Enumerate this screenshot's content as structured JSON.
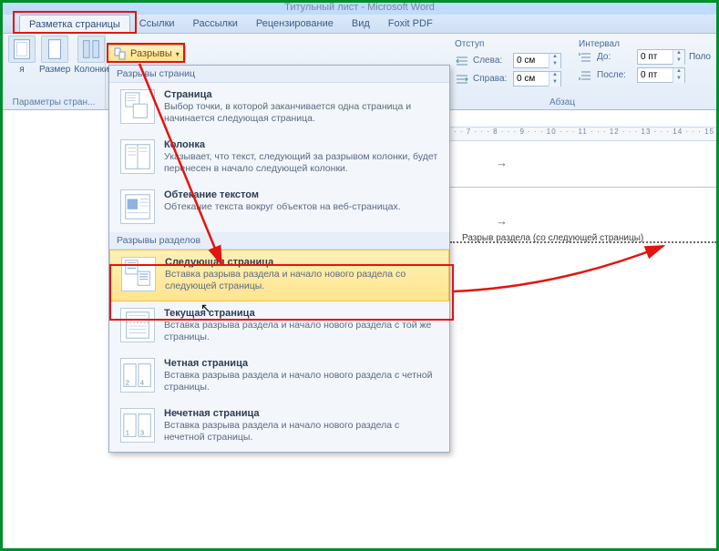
{
  "window": {
    "title": "Титульный лист - Microsoft Word"
  },
  "tabs": {
    "items": [
      "Разметка страницы",
      "Ссылки",
      "Рассылки",
      "Рецензирование",
      "Вид",
      "Foxit PDF"
    ],
    "active_index": 0
  },
  "ribbon": {
    "params_group_label": "Параметры стран...",
    "size_btn": "Размер",
    "columns_btn": "Колонки",
    "margins_btn": "я",
    "breaks_btn": "Разрывы",
    "indent": {
      "header": "Отступ",
      "left_label": "Слева:",
      "right_label": "Справа:",
      "left_value": "0 см",
      "right_value": "0 см"
    },
    "interval": {
      "header": "Интервал",
      "before_label": "До:",
      "after_label": "После:",
      "before_value": "0 пт",
      "after_value": "0 пт"
    },
    "para_label": "Абзац",
    "trail_btn": "Поло"
  },
  "dropdown": {
    "section_page": "Разрывы страниц",
    "section_sect": "Разрывы разделов",
    "items": [
      {
        "title": "Страница",
        "desc": "Выбор точки, в которой заканчивается одна страница и начинается следующая страница."
      },
      {
        "title": "Колонка",
        "desc": "Указывает, что текст, следующий за разрывом колонки, будет перенесен в начало следующей колонки."
      },
      {
        "title": "Обтекание текстом",
        "desc": "Обтекание текста вокруг объектов на веб-страницах."
      },
      {
        "title": "Следующая страница",
        "desc": "Вставка разрыва раздела и начало нового раздела со следующей страницы."
      },
      {
        "title": "Текущая страница",
        "desc": "Вставка разрыва раздела и начало нового раздела с той же страницы."
      },
      {
        "title": "Четная страница",
        "desc": "Вставка разрыва раздела и начало нового раздела с четной страницы."
      },
      {
        "title": "Нечетная страница",
        "desc": "Вставка разрыва раздела и начало нового раздела с нечетной страницы."
      }
    ]
  },
  "document": {
    "ruler_text": "· · 7 · · · 8 · · · 9 · · · 10 · · · 11 · · · 12 · · · 13 · · · 14 · · · 15 ·",
    "section_break_label": "Разрыв раздела (со следующей страницы)"
  }
}
